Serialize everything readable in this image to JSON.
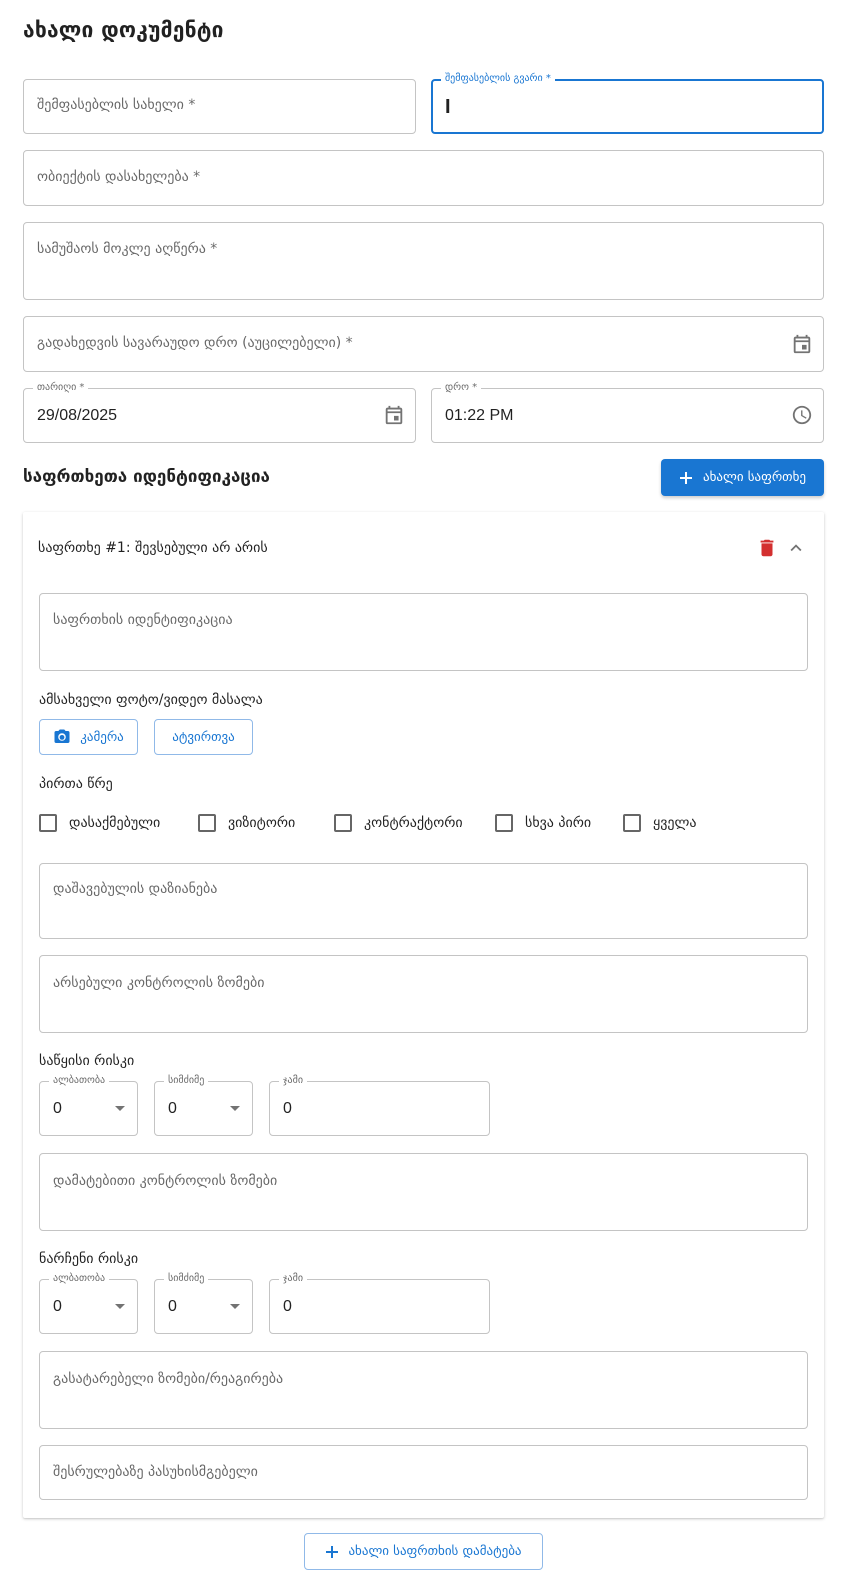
{
  "page": {
    "title": "ახალი დოკუმენტი"
  },
  "form": {
    "first_name_placeholder": "შემფასებლის სახელი *",
    "last_name_label": "შემფასებლის გვარი *",
    "last_name_value": "I",
    "object_placeholder": "ობიექტის დასახელება *",
    "work_description_placeholder": "სამუშაოს მოკლე აღწერა *",
    "review_date_placeholder": "გადახედვის სავარაუდო დრო (აუცილებელი) *",
    "date_label": "თარიღი *",
    "date_value": "29/08/2025",
    "time_label": "დრო *",
    "time_value": "01:22 PM"
  },
  "hazards_section": {
    "title": "საფრთხეთა იდენტიფიკაცია",
    "new_hazard_button": "ახალი საფრთხე",
    "add_new_hazard_button": "ახალი საფრთხის დამატება"
  },
  "hazard_card": {
    "header": "საფრთხე #1: შევსებული არ არის",
    "identification_placeholder": "საფრთხის იდენტიფიკაცია",
    "media_label": "ამსახველი ფოტო/ვიდეო მასალა",
    "camera_button": "კამერა",
    "upload_button": "ატვირთვა",
    "persons_label": "პირთა წრე",
    "persons": [
      {
        "label": "დასაქმებული",
        "checked": false
      },
      {
        "label": "ვიზიტორი",
        "checked": false
      },
      {
        "label": "კონტრაქტორი",
        "checked": false
      },
      {
        "label": "სხვა პირი",
        "checked": false
      },
      {
        "label": "ყველა",
        "checked": false
      }
    ],
    "injury_placeholder": "დაშავებულის დაზიანება",
    "existing_controls_placeholder": "არსებული კონტროლის ზომები",
    "initial_risk": {
      "label": "საწყისი რისკი",
      "probability_label": "ალბათობა",
      "probability_value": "0",
      "severity_label": "სიმძიმე",
      "severity_value": "0",
      "total_label": "ჯამი",
      "total_value": "0"
    },
    "additional_controls_placeholder": "დამატებითი კონტროლის ზომები",
    "residual_risk": {
      "label": "ნარჩენი რისკი",
      "probability_label": "ალბათობა",
      "probability_value": "0",
      "severity_label": "სიმძიმე",
      "severity_value": "0",
      "total_label": "ჯამი",
      "total_value": "0"
    },
    "measures_placeholder": "გასატარებელი ზომები/რეაგირება",
    "responsible_placeholder": "შესრულებაზე პასუხისმგებელი"
  },
  "colors": {
    "primary": "#1976d2",
    "delete": "#d32f2f",
    "border": "#c4c4c4"
  },
  "icons": [
    "calendar-icon",
    "clock-icon",
    "plus-icon",
    "trash-icon",
    "chevron-up-icon",
    "camera-icon"
  ]
}
